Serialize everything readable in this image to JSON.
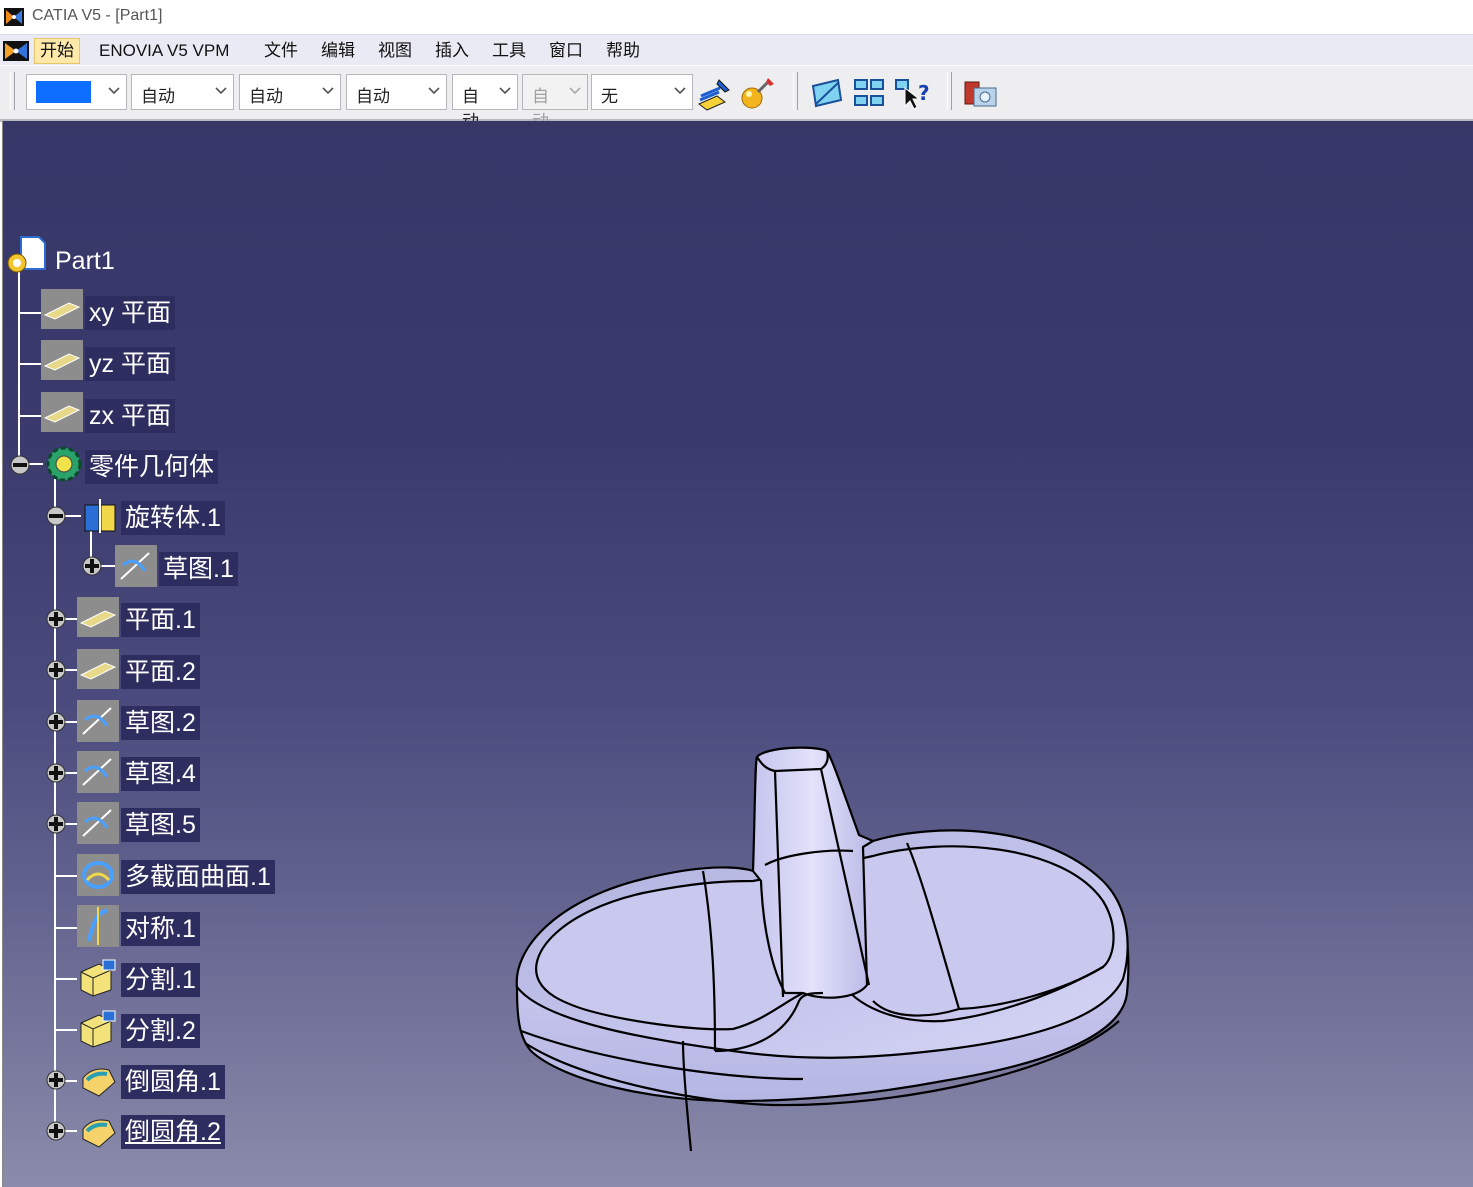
{
  "window": {
    "title": "CATIA V5 - [Part1]"
  },
  "menubar": {
    "items": [
      "开始",
      "ENOVIA V5 VPM",
      "文件",
      "编辑",
      "视图",
      "插入",
      "工具",
      "窗口",
      "帮助"
    ],
    "active_item": "开始"
  },
  "toolbar": {
    "color_swatch": "#0d6eff",
    "combos": [
      {
        "value": "自动",
        "disabled": false
      },
      {
        "value": "自动",
        "disabled": false
      },
      {
        "value": "自动",
        "disabled": false
      },
      {
        "value": "自动",
        "disabled": false
      },
      {
        "value": "自动",
        "disabled": true
      },
      {
        "value": "无",
        "disabled": false
      }
    ],
    "icons": [
      "graphic-properties-brush-icon",
      "painter-sphere-icon",
      "fly-mode-icon",
      "swap-visible-space-icon",
      "whats-this-help-icon",
      "catalog-browser-icon"
    ]
  },
  "tree": {
    "root": "Part1",
    "planes": [
      "xy 平面",
      "yz 平面",
      "zx 平面"
    ],
    "body": "零件几何体",
    "body_children": [
      {
        "label": "旋转体.1",
        "icon": "shaft-icon",
        "expanded": true
      },
      {
        "label": "草图.1",
        "icon": "sketch-icon",
        "nested": true
      },
      {
        "label": "平面.1",
        "icon": "plane-icon"
      },
      {
        "label": "平面.2",
        "icon": "plane-icon"
      },
      {
        "label": "草图.2",
        "icon": "sketch-icon"
      },
      {
        "label": "草图.4",
        "icon": "sketch-icon"
      },
      {
        "label": "草图.5",
        "icon": "sketch-icon"
      },
      {
        "label": "多截面曲面.1",
        "icon": "multi-section-surface-icon"
      },
      {
        "label": "对称.1",
        "icon": "symmetry-icon"
      },
      {
        "label": "分割.1",
        "icon": "split-icon"
      },
      {
        "label": "分割.2",
        "icon": "split-icon"
      },
      {
        "label": "倒圆角.1",
        "icon": "edge-fillet-icon"
      },
      {
        "label": "倒圆角.2",
        "icon": "edge-fillet-icon"
      }
    ]
  },
  "model": {
    "fill_color": "#c6c6ee",
    "edge_color": "#000000"
  }
}
